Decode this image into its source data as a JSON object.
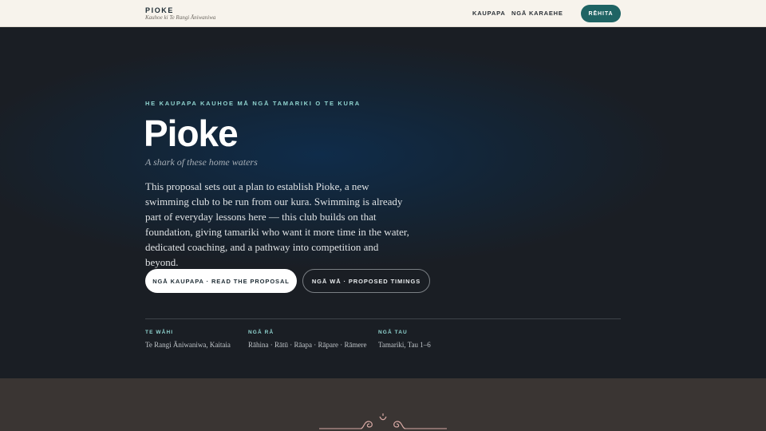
{
  "header": {
    "brand_name": "PIOKE",
    "brand_sub": "Kauhoe ki Te Rangi Āniwaniwa",
    "nav": [
      "KAUPAPA",
      "NGĀ KARAEHE"
    ],
    "cta_label": "RĒHITA"
  },
  "hero": {
    "eyebrow": "HE KAUPAPA KAUHOE MĀ NGĀ TAMARIKI O TE KURA",
    "title": "Pioke",
    "tagline": "A shark of these home waters",
    "lead": "This proposal sets out a plan to establish Pioke, a new swimming club to be run from our kura. Swimming is already part of everyday lessons here — this club builds on that foundation, giving tamariki who want it more time in the water, dedicated coaching, and a pathway into competition and beyond.",
    "primary_button": "NGĀ KAUPAPA · READ THE PROPOSAL",
    "secondary_button": "NGĀ WĀ · PROPOSED TIMINGS"
  },
  "meta": [
    {
      "label": "TE WĀHI",
      "value": "Te Rangi Āniwaniwa, Kaitaia"
    },
    {
      "label": "NGĀ RĀ",
      "value": "Rāhina · Rātū · Rāapa · Rāpare · Rāmere"
    },
    {
      "label": "NGĀ TAU",
      "value": "Tamariki, Tau 1–6"
    }
  ],
  "colors": {
    "accent": "#1f6464",
    "eyebrow": "#8fd3cf",
    "topbar_bg": "#f7f3ec",
    "lower_bg": "#3a3533"
  },
  "icons": [
    "wave-ornament-icon"
  ]
}
